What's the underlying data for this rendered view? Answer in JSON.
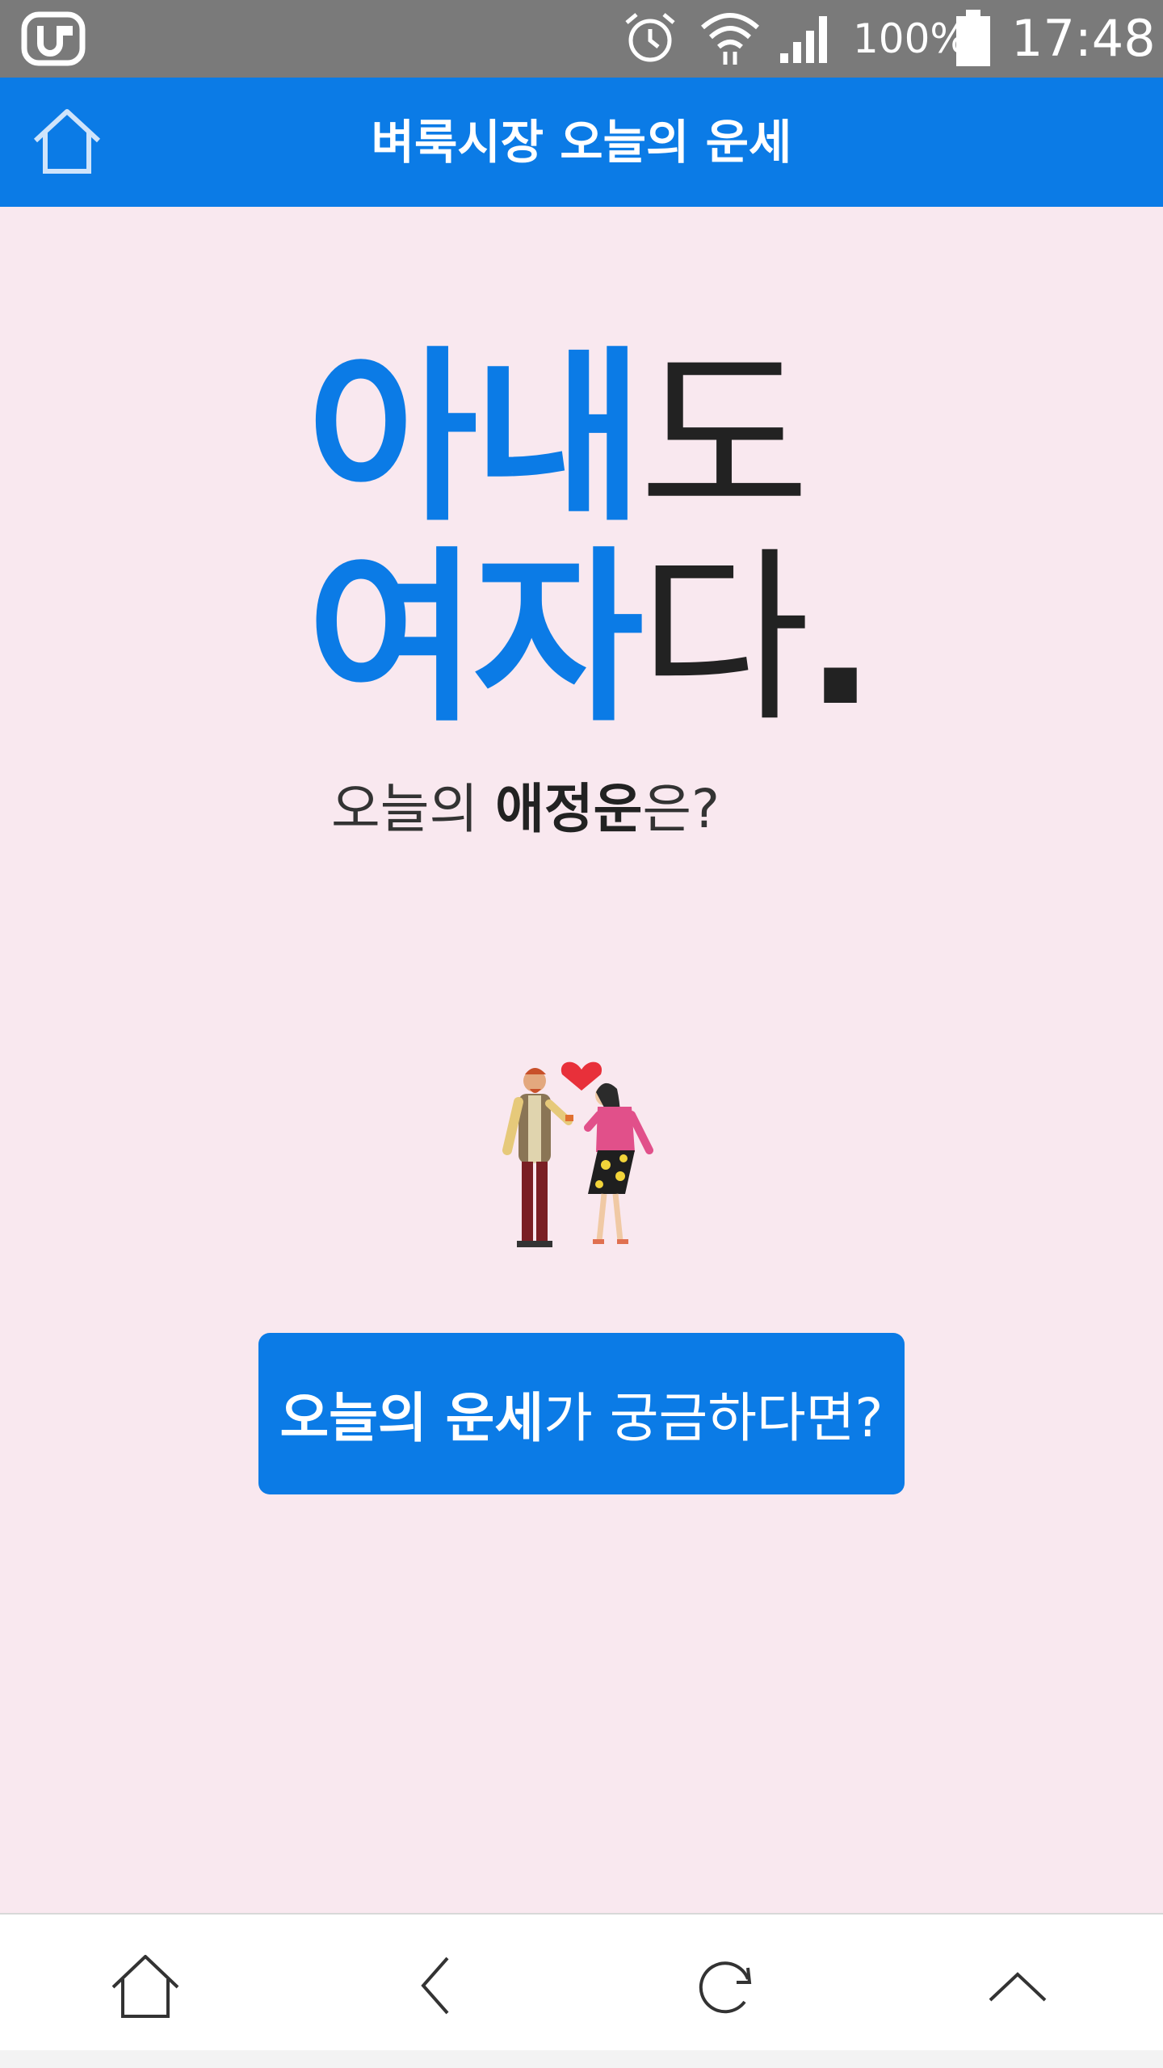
{
  "status_bar": {
    "battery_percent": "100%",
    "time": "17:48",
    "icons": [
      "carrier-logo-icon",
      "alarm-icon",
      "wifi-icon",
      "signal-icon",
      "battery-icon"
    ]
  },
  "app_bar": {
    "title": "벼룩시장 오늘의 운세",
    "home_icon": "home-icon"
  },
  "hero": {
    "line1_blue": "아내",
    "line1_dark": "도",
    "line2_blue": "여자",
    "line2_dark": "다",
    "line2_dot": ".",
    "subtitle_pre": "오늘의 ",
    "subtitle_bold": "애정운",
    "subtitle_post": "은?"
  },
  "illustration": {
    "icon": "couple-heart-icon"
  },
  "cta": {
    "bold": "오늘의 운세",
    "regular": "가 궁금하다면?"
  },
  "bottom_nav": {
    "items": [
      "home-icon",
      "back-icon",
      "refresh-icon",
      "scroll-top-icon"
    ]
  },
  "colors": {
    "brand_blue": "#0b7be6",
    "background_pink": "#f9e8ef",
    "status_bar_gray": "#7a7a7a",
    "heart_red": "#e8303a"
  }
}
